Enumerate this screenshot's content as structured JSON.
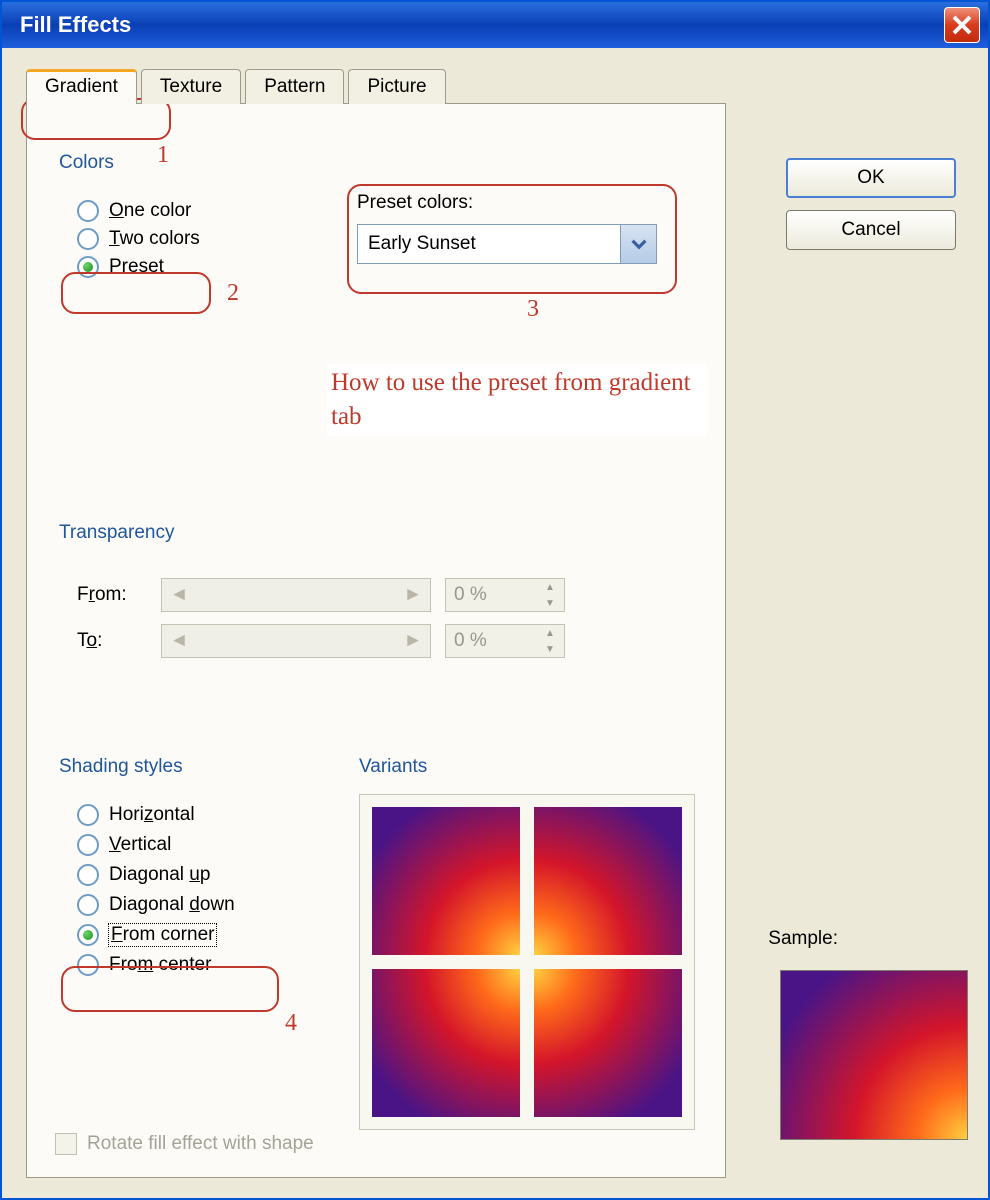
{
  "window": {
    "title": "Fill Effects"
  },
  "tabs": {
    "items": [
      "Gradient",
      "Texture",
      "Pattern",
      "Picture"
    ],
    "active_index": 0
  },
  "buttons": {
    "ok": "OK",
    "cancel": "Cancel"
  },
  "colors": {
    "group_label": "Colors",
    "options": {
      "one": "One color",
      "two": "Two colors",
      "preset": "Preset"
    },
    "selected": "preset",
    "preset_label": "Preset colors:",
    "preset_value": "Early Sunset"
  },
  "transparency": {
    "group_label": "Transparency",
    "from_label": "From:",
    "to_label": "To:",
    "from_value": "0 %",
    "to_value": "0 %"
  },
  "shading": {
    "group_label": "Shading styles",
    "options": {
      "horizontal": "Horizontal",
      "vertical": "Vertical",
      "diag_up": "Diagonal up",
      "diag_down": "Diagonal down",
      "from_corner": "From corner",
      "from_center": "From center"
    },
    "selected": "from_corner"
  },
  "variants": {
    "group_label": "Variants"
  },
  "sample": {
    "label": "Sample:"
  },
  "rotate": {
    "label": "Rotate fill effect with shape",
    "checked": false,
    "enabled": false
  },
  "annotations": {
    "n1": "1",
    "n2": "2",
    "n3": "3",
    "n4": "4",
    "text": "How to use the preset from gradient tab"
  }
}
